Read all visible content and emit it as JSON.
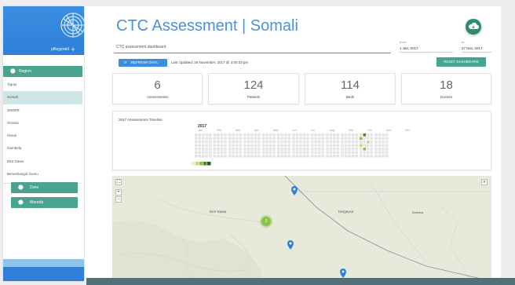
{
  "sidebar": {
    "username": "pfitzgerald",
    "plus_label": "+",
    "region_label": "Region",
    "regions": [
      "Tigray",
      "Somali",
      "SNNPR",
      "Oromia",
      "Harari",
      "Gambela",
      "Dire Dawa",
      "Beneshangul Gumu"
    ],
    "active_region": "Somali",
    "zone_label": "Zone",
    "woreda_label": "Woreda"
  },
  "header": {
    "title": "CTC Assessment | Somali",
    "subtitle": "CTC assessment dashboard",
    "from_label": "from",
    "from_value": "1 Jan, 2017",
    "to_label": "to",
    "to_value": "27 Nov, 2017"
  },
  "toolbar": {
    "refresh_label": "REFRESH DATA",
    "last_updated": "Last Updated: 26 November, 2017 @ 3:00:03 pm",
    "reset_label": "RESET DASHBOARD"
  },
  "stats": [
    {
      "value": "6",
      "label": "Assessments"
    },
    {
      "value": "124",
      "label": "Patients"
    },
    {
      "value": "114",
      "label": "Beds"
    },
    {
      "value": "18",
      "label": "Doctors"
    }
  ],
  "timeline": {
    "title": "2017 Assessments Timeline",
    "year": "2017",
    "months": [
      "Jan",
      "Feb",
      "Mar",
      "Apr",
      "May",
      "Jun",
      "Jul",
      "Aug",
      "Sep",
      "Oct",
      "Nov",
      "Dec"
    ],
    "legend_colors": [
      "#e8f1c4",
      "#c2dc7f",
      "#8fbf4d",
      "#4d8a2c",
      "#2c5a17"
    ]
  },
  "map": {
    "zoom_in": "+",
    "zoom_out": "−",
    "cluster_count": "2",
    "places": [
      "Dire Dawa",
      "Hargeysa",
      "Berbera"
    ],
    "colors": {
      "marker": "#2f7fd8",
      "cluster": "#8bc34a"
    }
  },
  "colors": {
    "brand_blue": "#3b8ee0",
    "teal": "#4aa38f",
    "title_blue": "#4a90d9"
  },
  "icons": {
    "cloud": "cloud-download-icon",
    "pin": "location-pin-icon",
    "refresh": "refresh-icon",
    "fullscreen": "fullscreen-icon",
    "search": "search-icon"
  }
}
